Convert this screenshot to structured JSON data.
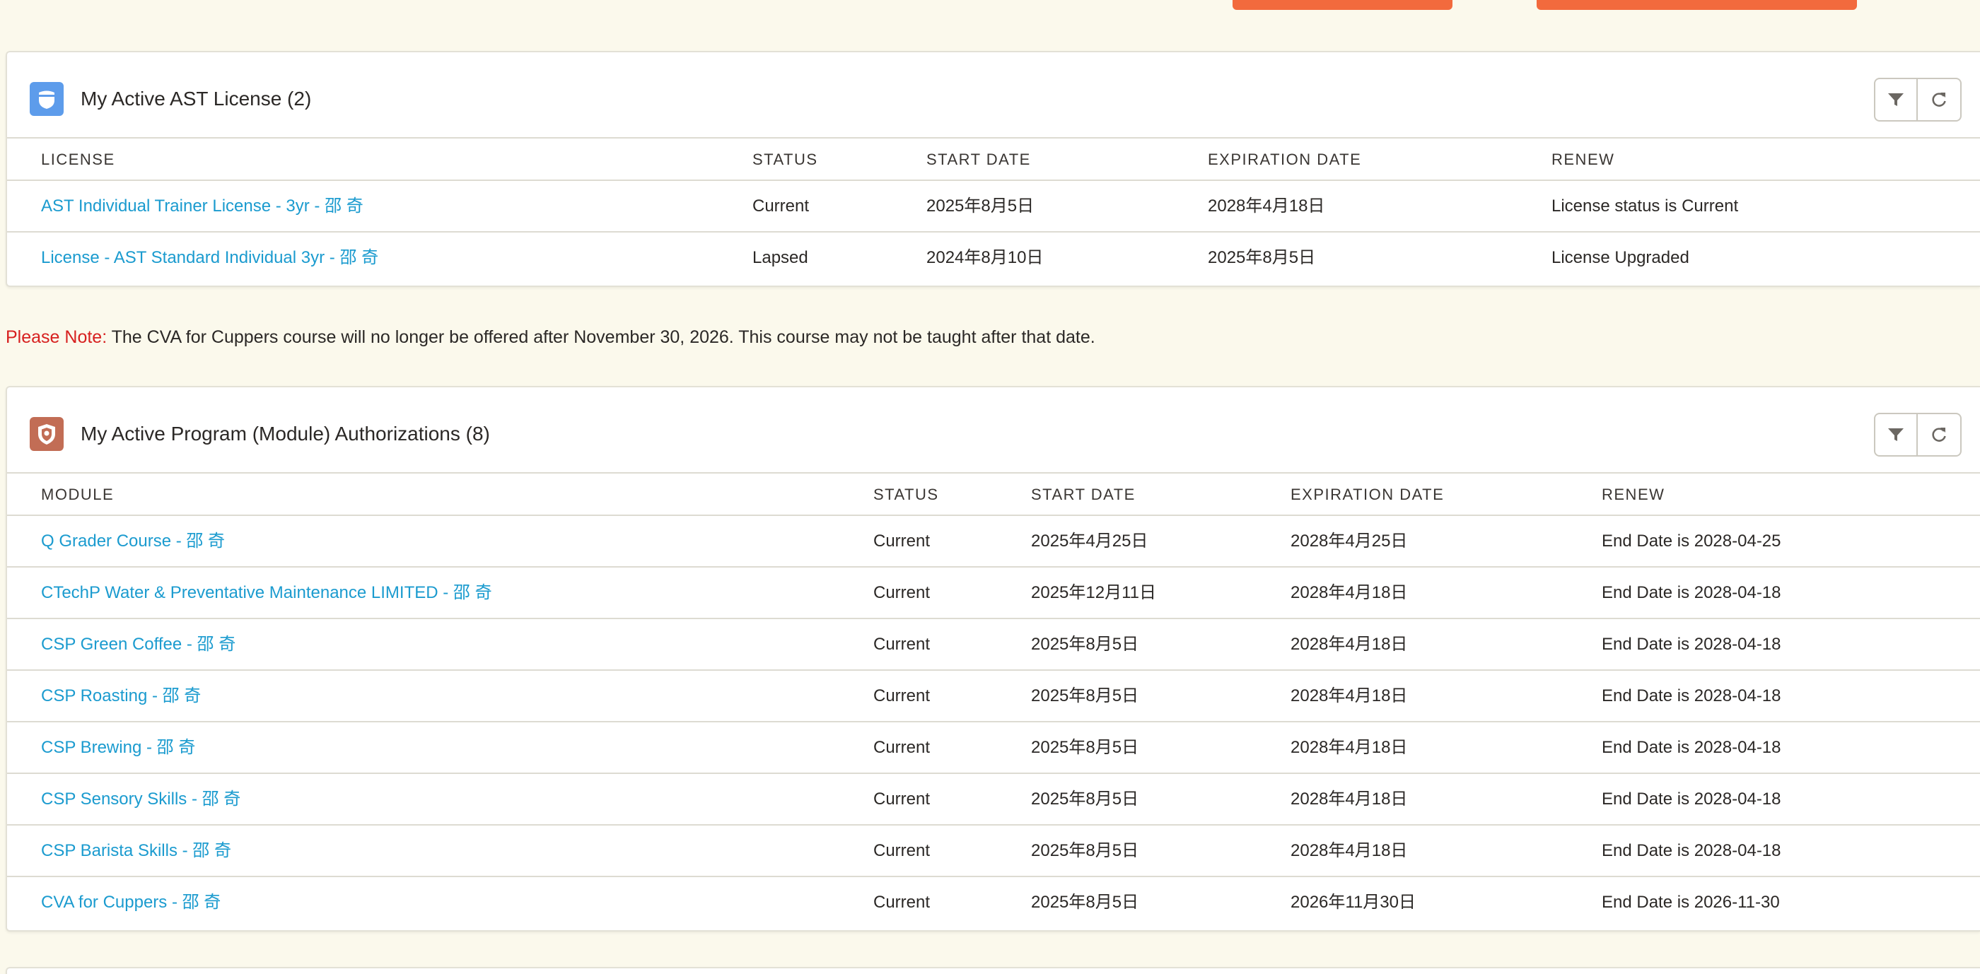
{
  "license_section": {
    "title": "My Active AST License (2)",
    "columns": [
      "LICENSE",
      "STATUS",
      "START DATE",
      "EXPIRATION DATE",
      "RENEW"
    ],
    "rows": [
      {
        "name": "AST Individual Trainer License - 3yr - 邵 奇",
        "status": "Current",
        "start": "2025年8月5日",
        "expiration": "2028年4月18日",
        "renew": "License status is Current"
      },
      {
        "name": "License - AST Standard Individual 3yr - 邵 奇",
        "status": "Lapsed",
        "start": "2024年8月10日",
        "expiration": "2025年8月5日",
        "renew": "License Upgraded"
      }
    ]
  },
  "note": {
    "label": "Please Note:",
    "text": " The CVA for Cuppers course will no longer be offered after November 30, 2026. This course may not be taught after that date."
  },
  "module_section": {
    "title": "My Active Program (Module) Authorizations (8)",
    "columns": [
      "MODULE",
      "STATUS",
      "START DATE",
      "EXPIRATION DATE",
      "RENEW"
    ],
    "rows": [
      {
        "name": "Q Grader Course - 邵 奇",
        "status": "Current",
        "start": "2025年4月25日",
        "expiration": "2028年4月25日",
        "renew": "End Date is 2028-04-25"
      },
      {
        "name": "CTechP Water & Preventative Maintenance LIMITED - 邵 奇",
        "status": "Current",
        "start": "2025年12月11日",
        "expiration": "2028年4月18日",
        "renew": "End Date is 2028-04-18"
      },
      {
        "name": "CSP Green Coffee - 邵 奇",
        "status": "Current",
        "start": "2025年8月5日",
        "expiration": "2028年4月18日",
        "renew": "End Date is 2028-04-18"
      },
      {
        "name": "CSP Roasting - 邵 奇",
        "status": "Current",
        "start": "2025年8月5日",
        "expiration": "2028年4月18日",
        "renew": "End Date is 2028-04-18"
      },
      {
        "name": "CSP Brewing - 邵 奇",
        "status": "Current",
        "start": "2025年8月5日",
        "expiration": "2028年4月18日",
        "renew": "End Date is 2028-04-18"
      },
      {
        "name": "CSP Sensory Skills - 邵 奇",
        "status": "Current",
        "start": "2025年8月5日",
        "expiration": "2028年4月18日",
        "renew": "End Date is 2028-04-18"
      },
      {
        "name": "CSP Barista Skills - 邵 奇",
        "status": "Current",
        "start": "2025年8月5日",
        "expiration": "2028年4月18日",
        "renew": "End Date is 2028-04-18"
      },
      {
        "name": "CVA for Cuppers - 邵 奇",
        "status": "Current",
        "start": "2025年8月5日",
        "expiration": "2026年11月30日",
        "renew": "End Date is 2026-11-30"
      }
    ]
  },
  "icons": {
    "license_icon": "shield-badge-icon",
    "module_icon": "shield-award-icon",
    "filter": "filter-icon",
    "refresh": "refresh-icon"
  },
  "colors": {
    "background": "#fbf9ec",
    "link": "#1b9bcf",
    "note_label": "#d7201f",
    "top_buttons": "#f26a3d",
    "license_icon_bg": "#5d9ceb",
    "module_icon_bg": "#c26d55"
  }
}
